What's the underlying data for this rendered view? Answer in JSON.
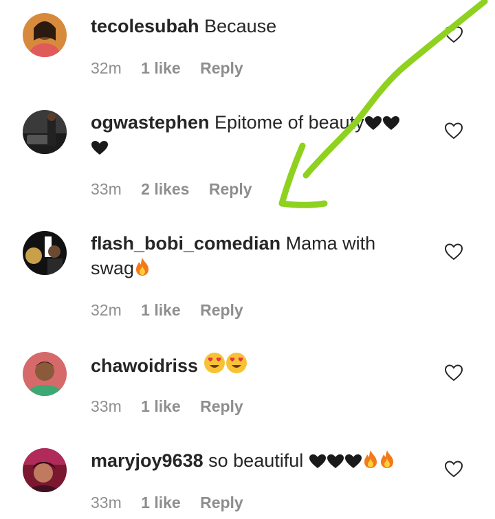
{
  "comments": [
    {
      "username": "tecolesubah",
      "text": "Because",
      "time": "32m",
      "likes": "1 like",
      "reply": "Reply",
      "emojis": []
    },
    {
      "username": "ogwastephen",
      "text": "Epitome of beauty",
      "time": "33m",
      "likes": "2 likes",
      "reply": "Reply",
      "emojis": [
        "black-heart",
        "black-heart",
        "black-heart"
      ]
    },
    {
      "username": "flash_bobi_comedian",
      "text": "Mama with swag",
      "time": "32m",
      "likes": "1 like",
      "reply": "Reply",
      "emojis": [
        "fire"
      ]
    },
    {
      "username": "chawoidriss",
      "text": "",
      "time": "33m",
      "likes": "1 like",
      "reply": "Reply",
      "emojis": [
        "heart-eyes",
        "heart-eyes"
      ]
    },
    {
      "username": "maryjoy9638",
      "text": "so beautiful",
      "time": "33m",
      "likes": "1 like",
      "reply": "Reply",
      "emojis": [
        "black-heart",
        "black-heart",
        "black-heart",
        "fire",
        "fire"
      ]
    }
  ],
  "icons": {
    "like": "heart-outline-icon"
  },
  "colors": {
    "text": "#262626",
    "meta": "#8e8e8e",
    "arrow": "#8fd11f"
  }
}
